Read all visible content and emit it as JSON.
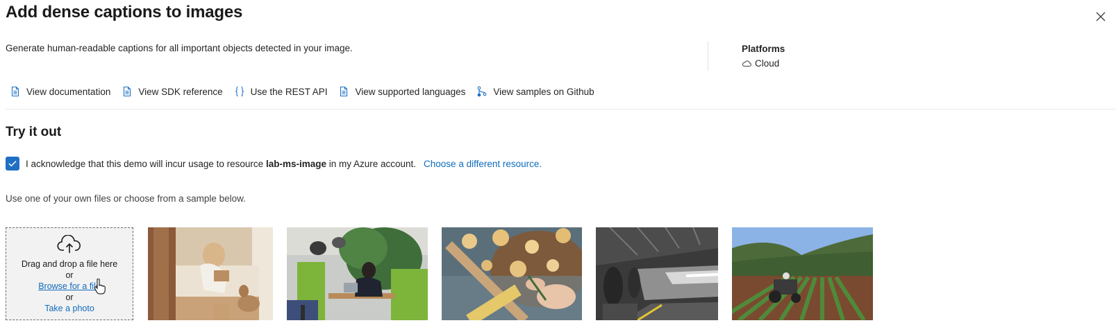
{
  "header": {
    "title": "Add dense captions to images",
    "description": "Generate human-readable captions for all important objects detected in your image."
  },
  "platforms": {
    "heading": "Platforms",
    "item": "Cloud"
  },
  "links": [
    {
      "label": "View documentation",
      "icon": "document-icon"
    },
    {
      "label": "View SDK reference",
      "icon": "document-icon"
    },
    {
      "label": "Use the REST API",
      "icon": "braces-icon"
    },
    {
      "label": "View supported languages",
      "icon": "document-icon"
    },
    {
      "label": "View samples on Github",
      "icon": "branch-icon"
    }
  ],
  "try_it": {
    "title": "Try it out",
    "ack_prefix": "I acknowledge that this demo will incur usage to resource ",
    "ack_resource": "lab-ms-image",
    "ack_suffix": " in my Azure account.",
    "ack_link": "Choose a different resource.",
    "checked": true,
    "hint": "Use one of your own files or choose from a sample below."
  },
  "upload": {
    "drag_text": "Drag and drop a file here",
    "or1": "or",
    "browse": "Browse for a file",
    "or2": "or",
    "photo": "Take a photo"
  },
  "samples": [
    {
      "name": "woman-with-dog-on-bed"
    },
    {
      "name": "person-at-laptop-in-office"
    },
    {
      "name": "pasta-preparation"
    },
    {
      "name": "train-station-platform"
    },
    {
      "name": "tractor-in-field"
    }
  ],
  "colors": {
    "accent": "#0f6cbd",
    "checkbox": "#1f6fc4"
  }
}
